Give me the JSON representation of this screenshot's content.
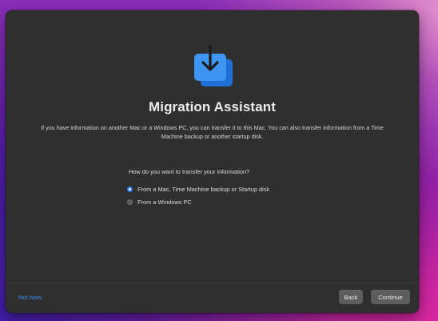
{
  "app": {
    "title": "Migration Assistant",
    "icon": "migration-assistant-icon",
    "accent_color": "#3a8ef2"
  },
  "main": {
    "description": "If you have information on another Mac or a Windows PC, you can transfer it to this Mac. You can also transfer information from a Time Machine backup or another startup disk.",
    "question": "How do you want to transfer your information?",
    "options": [
      {
        "label": "From a Mac, Time Machine backup or Startup disk",
        "selected": true
      },
      {
        "label": "From a Windows PC",
        "selected": false
      }
    ]
  },
  "footer": {
    "not_now_label": "Not Now",
    "back_label": "Back",
    "continue_label": "Continue"
  }
}
